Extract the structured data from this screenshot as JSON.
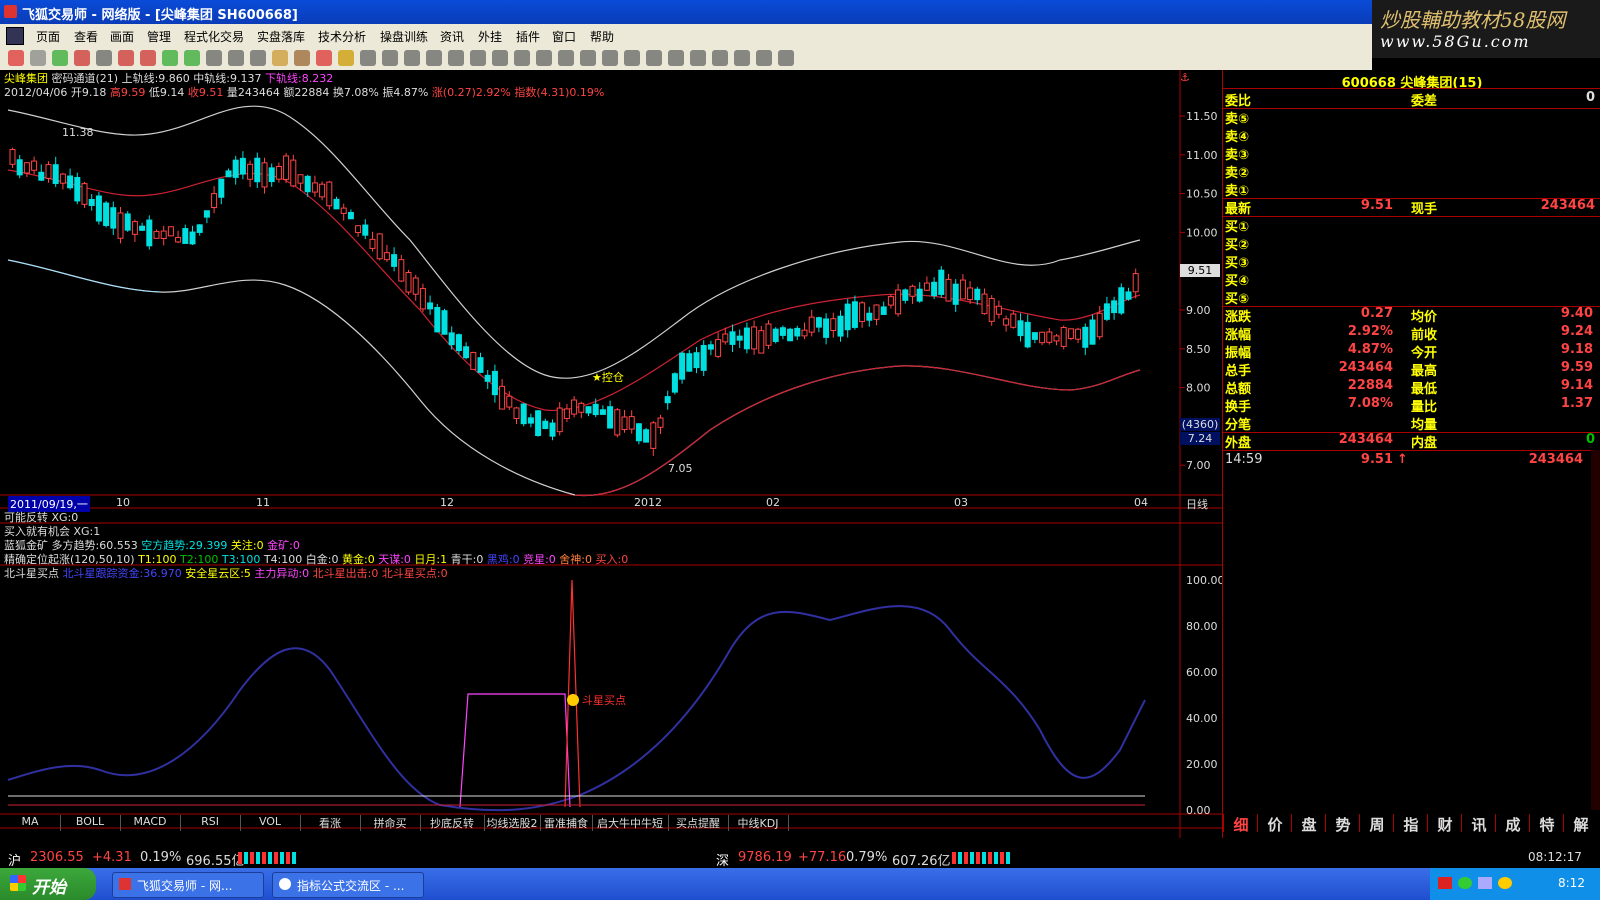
{
  "window": {
    "title": "飞狐交易师 - 网络版 - [尖峰集团 SH600668]"
  },
  "brand": {
    "line1": "炒股輔助教材58股网",
    "line2": "www.58Gu.com"
  },
  "menu": [
    "页面",
    "查看",
    "画面",
    "管理",
    "程式化交易",
    "实盘落库",
    "技术分析",
    "操盘训练",
    "资讯",
    "外挂",
    "插件",
    "窗口",
    "帮助"
  ],
  "chart": {
    "indicator_line1": {
      "name": "尖峰集团",
      "ind": "密码通道(21)",
      "upper": "上轨线:9.860",
      "mid": "中轨线:9.137",
      "lower": "下轨线:8.232"
    },
    "indicator_line2": {
      "date": "2012/04/06",
      "open": "开9.18",
      "high": "高9.59",
      "low": "低9.14",
      "close": "收9.51",
      "vol": "量243464",
      "amt": "额22884",
      "turn": "换7.08%",
      "amp": "振4.87%",
      "chg": "涨(0.27)2.92%",
      "idx": "指数(4.31)0.19%"
    },
    "price_labels": [
      "11.50",
      "11.00",
      "10.50",
      "10.00",
      "9.50",
      "9.00",
      "8.50",
      "8.00",
      "7.50",
      "7.00"
    ],
    "current_price_tag": "9.51",
    "vol_tag": "(4360)",
    "vol_tag2": "7.24",
    "hi_label": "11.38",
    "lo_label": "7.05",
    "signal_label": "控仓",
    "date_axis": [
      "2011/09/19,一",
      "10",
      "11",
      "12",
      "2012",
      "02",
      "03",
      "04"
    ],
    "period": "日线"
  },
  "indicators": {
    "row1": "可能反转 XG:0",
    "row2": "买入就有机会 XG:1",
    "row3": {
      "a": "蓝狐金矿",
      "b": "多方趋势:60.553",
      "c": "空方趋势:29.399",
      "d": "关注:0",
      "e": "金矿:0"
    },
    "row4": {
      "a": "精确定位起涨(120,50,10)",
      "b": "T1:100",
      "c": "T2:100",
      "d": "T3:100",
      "e": "T4:100",
      "f": "白金:0",
      "g": "黄金:0",
      "h": "天谋:0",
      "i": "日月:1",
      "j": "青干:0",
      "k": "黑鸡:0",
      "l": "竞星:0",
      "m": "舍神:0",
      "n": "买入:0"
    },
    "row5": {
      "a": "北斗星买点",
      "b": "北斗星跟踪资金:36.970",
      "c": "安全星云区:5",
      "d": "主力异动:0",
      "e": "北斗星出击:0",
      "f": "北斗星买点:0"
    },
    "osc_labels": [
      "100.00",
      "80.00",
      "60.00",
      "40.00",
      "20.00",
      "0.00"
    ],
    "buy_label": "斗星买点"
  },
  "bottom_tabs": [
    "MA",
    "BOLL",
    "MACD",
    "RSI",
    "VOL",
    "看涨",
    "拼命买",
    "抄底反转",
    "均线选股2",
    "雷准捕食",
    "启大牛中牛短",
    "买点提醒",
    "中线KDJ"
  ],
  "quote": {
    "header": "600668 尖峰集团(15)",
    "weibi": "委比",
    "weicha": "委差",
    "weicha_val": "0",
    "sells": [
      "卖⑤",
      "卖④",
      "卖③",
      "卖②",
      "卖①"
    ],
    "latest_label": "最新",
    "latest": "9.51",
    "xianshou_label": "现手",
    "xianshou": "243464",
    "buys": [
      "买①",
      "买②",
      "买③",
      "买④",
      "买⑤"
    ],
    "stats": [
      [
        "涨跌",
        "0.27",
        "均价",
        "9.40"
      ],
      [
        "涨幅",
        "2.92%",
        "前收",
        "9.24"
      ],
      [
        "振幅",
        "4.87%",
        "今开",
        "9.18"
      ],
      [
        "总手",
        "243464",
        "最高",
        "9.59"
      ],
      [
        "总额",
        "22884",
        "最低",
        "9.14"
      ],
      [
        "换手",
        "7.08%",
        "量比",
        "1.37"
      ],
      [
        "分笔",
        "",
        "均量",
        ""
      ]
    ],
    "waipan_label": "外盘",
    "waipan": "243464",
    "neipan_label": "内盘",
    "neipan": "0",
    "tick": {
      "time": "14:59",
      "price": "9.51",
      "arrow": "↑",
      "vol": "243464"
    },
    "bottom_tabs": [
      "细",
      "价",
      "盘",
      "势",
      "周",
      "指",
      "财",
      "讯",
      "成",
      "特",
      "解"
    ]
  },
  "status": {
    "sh_label": "沪",
    "sh_idx": "2306.55",
    "sh_chg": "+4.31",
    "sh_pct": "0.19%",
    "sh_amt": "696.55亿",
    "sz_label": "深",
    "sz_idx": "9786.19",
    "sz_chg": "+77.16",
    "sz_pct": "0.79%",
    "sz_amt": "607.26亿",
    "time": "08:12:17"
  },
  "taskbar": {
    "start": "开始",
    "task1": "飞狐交易师 - 网...",
    "task2": "指标公式交流区 - ...",
    "clock": "8:12"
  }
}
